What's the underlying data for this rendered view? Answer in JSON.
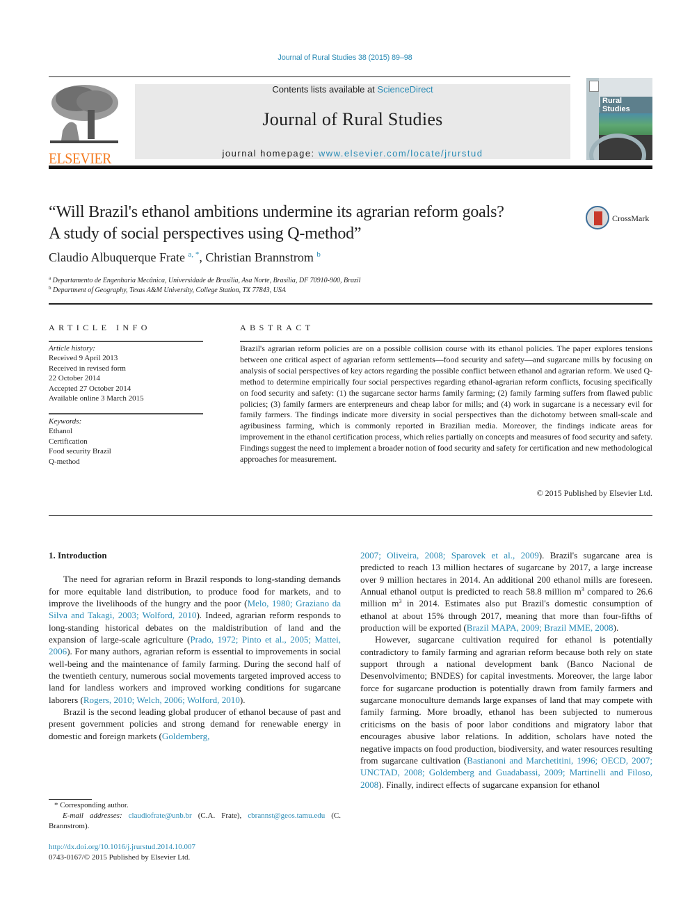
{
  "header": {
    "journal_ref": "Journal of Rural Studies 38 (2015) 89–98",
    "contents_prefix": "Contents lists available at ",
    "contents_link": "ScienceDirect",
    "journal_name": "Journal of Rural Studies",
    "homepage_prefix": "journal homepage: ",
    "homepage_link": "www.elsevier.com/locate/jrurstud",
    "publisher_logo_text": "ELSEVIER",
    "cover_title": "Rural Studies",
    "crossmark_label": "CrossMark",
    "accent_color": "#2a8bb5",
    "publisher_color": "#f47b20"
  },
  "article": {
    "title_line1": "“Will Brazil's ethanol ambitions undermine its agrarian reform goals?",
    "title_line2": "A study of social perspectives using Q-method”",
    "authors": [
      {
        "name": "Claudio Albuquerque Frate",
        "marks": "a, *"
      },
      {
        "name": "Christian Brannstrom",
        "marks": "b"
      }
    ],
    "author_separator": ", ",
    "affiliations": [
      {
        "mark": "a",
        "text": "Departamento de Engenharia Mecânica, Universidade de Brasília, Asa Norte, Brasília, DF 70910-900, Brazil"
      },
      {
        "mark": "b",
        "text": "Department of Geography, Texas A&M University, College Station, TX 77843, USA"
      }
    ]
  },
  "article_info": {
    "heading": "ARTICLE INFO",
    "history_label": "Article history:",
    "history": [
      "Received 9 April 2013",
      "Received in revised form",
      "22 October 2014",
      "Accepted 27 October 2014",
      "Available online 3 March 2015"
    ],
    "keywords_label": "Keywords:",
    "keywords": [
      "Ethanol",
      "Certification",
      "Food security Brazil",
      "Q-method"
    ]
  },
  "abstract": {
    "heading": "ABSTRACT",
    "text": "Brazil's agrarian reform policies are on a possible collision course with its ethanol policies. The paper explores tensions between one critical aspect of agrarian reform settlements—food security and safety—and sugarcane mills by focusing on analysis of social perspectives of key actors regarding the possible conflict between ethanol and agrarian reform. We used Q-method to determine empirically four social perspectives regarding ethanol-agrarian reform conflicts, focusing specifically on food security and safety: (1) the sugarcane sector harms family farming; (2) family farming suffers from flawed public policies; (3) family farmers are enterpreneurs and cheap labor for mills; and (4) work in sugarcane is a necessary evil for family farmers. The findings indicate more diversity in social perspectives than the dichotomy between small-scale and agribusiness farming, which is commonly reported in Brazilian media. Moreover, the findings indicate areas for improvement in the ethanol certification process, which relies partially on concepts and measures of food security and safety. Findings suggest the need to implement a broader notion of food security and safety for certification and new methodological approaches for measurement.",
    "copyright": "© 2015 Published by Elsevier Ltd."
  },
  "body": {
    "section_heading": "1.  Introduction",
    "left": {
      "p1_a": "The need for agrarian reform in Brazil responds to long-standing demands for more equitable land distribution, to produce food for markets, and to improve the livelihoods of the hungry and the poor (",
      "p1_cite1": "Melo, 1980; Graziano da Silva and Takagi, 2003; Wolford, 2010",
      "p1_b": "). Indeed, agrarian reform responds to long-standing historical debates on the maldistribution of land and the expansion of large-scale agriculture (",
      "p1_cite2": "Prado, 1972; Pinto et al., 2005; Mattei, 2006",
      "p1_c": "). For many authors, agrarian reform is essential to improvements in social well-being and the maintenance of family farming. During the second half of the twentieth century, numerous social movements targeted improved access to land for landless workers and improved working conditions for sugarcane laborers (",
      "p1_cite3": "Rogers, 2010; Welch, 2006; Wolford, 2010",
      "p1_d": ").",
      "p2_a": "Brazil is the second leading global producer of ethanol because of past and present government policies and strong demand for renewable energy in domestic and foreign markets (",
      "p2_cite1": "Goldemberg,"
    },
    "right": {
      "p2_cite1_cont": "2007; Oliveira, 2008; Sparovek et al., 2009",
      "p2_b": "). Brazil's sugarcane area is predicted to reach 13 million hectares of sugarcane by 2017, a large increase over 9 million hectares in 2014. An additional 200 ethanol mills are foreseen. Annual ethanol output is predicted to reach 58.8 million m",
      "p2_sup1": "3",
      "p2_c": " compared to 26.6 million m",
      "p2_sup2": "3",
      "p2_d": " in 2014. Estimates also put Brazil's domestic consumption of ethanol at about 15% through 2017, meaning that more than four-fifths of production will be exported (",
      "p2_cite2": "Brazil MAPA, 2009; Brazil MME, 2008",
      "p2_e": ").",
      "p3_a": "However, sugarcane cultivation required for ethanol is potentially contradictory to family farming and agrarian reform because both rely on state support through a national development bank (Banco Nacional de Desenvolvimento; BNDES) for capital investments. Moreover, the large labor force for sugarcane production is potentially drawn from family farmers and sugarcane monoculture demands large expanses of land that may compete with family farming. More broadly, ethanol has been subjected to numerous criticisms on the basis of poor labor conditions and migratory labor that encourages abusive labor relations. In addition, scholars have noted the negative impacts on food production, biodiversity, and water resources resulting from sugarcane cultivation (",
      "p3_cite1": "Bastianoni and Marchetitini, 1996; OECD, 2007; UNCTAD, 2008; Goldemberg and Guadabassi, 2009; Martinelli and Filoso, 2008",
      "p3_b": "). Finally, indirect effects of sugarcane expansion for ethanol"
    }
  },
  "footnotes": {
    "corresponding": "* Corresponding author.",
    "email_label": "E-mail addresses:",
    "email1": "claudiofrate@unb.br",
    "email1_owner": " (C.A. Frate), ",
    "email2": "cbrannst@geos.tamu.edu",
    "email2_owner": "(C. Brannstrom).",
    "doi": "http://dx.doi.org/10.1016/j.jrurstud.2014.10.007",
    "issn_copyright": "0743-0167/© 2015 Published by Elsevier Ltd."
  }
}
